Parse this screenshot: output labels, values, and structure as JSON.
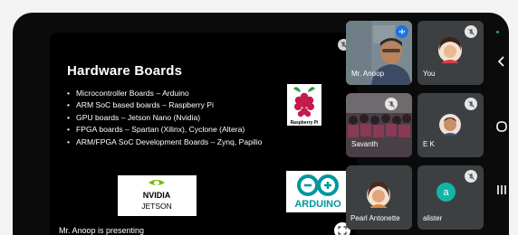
{
  "slide": {
    "title": "Hardware Boards",
    "bullets": [
      "Microcontroller Boards – Arduino",
      "ARM SoC based boards – Raspberry Pi",
      "GPU boards – Jetson Nano (Nvidia)",
      "FPGA boards – Spartan (Xilinx), Cyclone (Altera)",
      "ARM/FPGA SoC Development Boards – Zynq, Papilio"
    ],
    "rpi_logo_text": "Raspberry Pi",
    "nvidia_logo_text": "NVIDIA",
    "jetson_logo_text": "JETSON",
    "arduino_logo_text": "ARDUINO"
  },
  "presenting_label": "Mr. Anoop is presenting",
  "participants": [
    {
      "name": "Mr. Anoop",
      "state": "speaking"
    },
    {
      "name": "You",
      "state": "muted"
    },
    {
      "name": "Savanth",
      "state": "muted"
    },
    {
      "name": "E K",
      "state": "muted"
    },
    {
      "name": "Pearl Antonette",
      "state": "unmuted"
    },
    {
      "name": "alister",
      "state": "muted",
      "avatar_letter": "a"
    }
  ],
  "colors": {
    "background": "#000000",
    "tile": "#3c4043",
    "speaking": "#1a73e8",
    "avatar": "#12b5a6",
    "status_dot": "#34a853"
  }
}
